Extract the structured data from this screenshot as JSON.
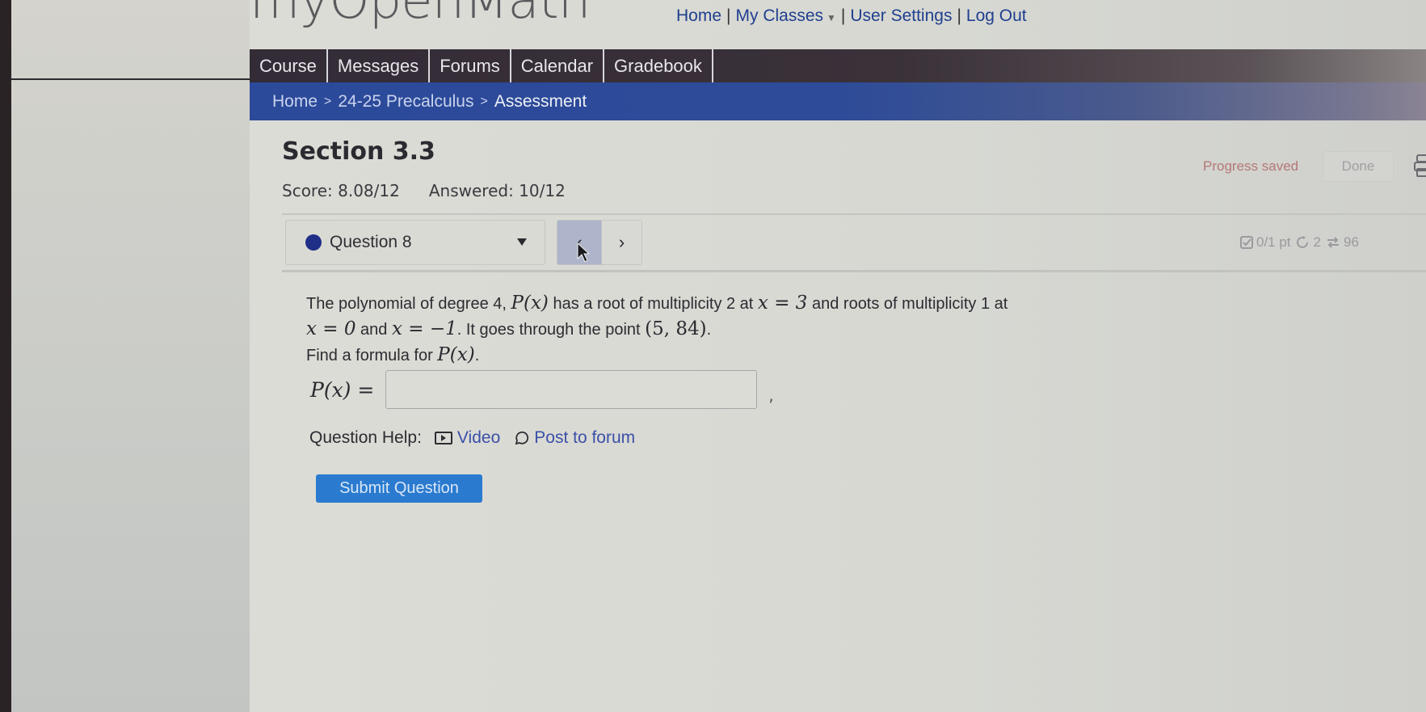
{
  "header": {
    "logo": "myOpenMath",
    "links": [
      {
        "label": "Home"
      },
      {
        "label": "My Classes"
      },
      {
        "label": "User Settings"
      },
      {
        "label": "Log Out"
      }
    ]
  },
  "nav": {
    "tabs": [
      {
        "label": "Course"
      },
      {
        "label": "Messages"
      },
      {
        "label": "Forums"
      },
      {
        "label": "Calendar"
      },
      {
        "label": "Gradebook"
      }
    ]
  },
  "breadcrumb": {
    "items": [
      "Home",
      "24-25 Precalculus",
      "Assessment"
    ],
    "separator": ">"
  },
  "assessment": {
    "title": "Section 3.3",
    "score": "Score: 8.08/12",
    "answered": "Answered: 10/12",
    "progress_status": "Progress saved",
    "done_label": "Done"
  },
  "question_nav": {
    "selected": "Question 8",
    "status_color": "#1f2f88",
    "prev_label": "‹",
    "next_label": "›",
    "points": "0/1 pt",
    "attempts": "2",
    "versions": "96"
  },
  "question": {
    "line1_a": "The polynomial of degree 4, ",
    "line1_math1": "P(x)",
    "line1_b": " has a root of multiplicity 2 at ",
    "line1_math2": "x = 3",
    "line1_c": " and roots of multiplicity 1 at",
    "line2_math1": "x = 0",
    "line2_a": " and ",
    "line2_math2": "x = −1",
    "line2_b": ". It goes through the point ",
    "line2_math3": "(5, 84)",
    "line2_c": ".",
    "line3_a": "Find a formula for ",
    "line3_math": "P(x)",
    "line3_b": ".",
    "answer_label": "P(x) =",
    "answer_value": "",
    "answer_suffix": ","
  },
  "help": {
    "label": "Question Help:",
    "video": "Video",
    "forum": "Post to forum"
  },
  "submit_label": "Submit Question",
  "colors": {
    "nav_bg": "#332b36",
    "breadcrumb_bg": "#2c4a9a",
    "submit_bg": "#2a7bd0",
    "link": "#1f3f8f"
  }
}
